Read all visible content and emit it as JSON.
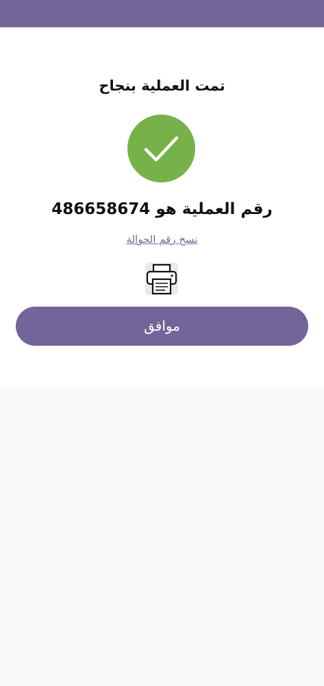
{
  "header": {
    "color": "#73659a"
  },
  "result": {
    "title": "تمت العملية بنجاح",
    "status_icon": "check-circle-icon",
    "success_color": "#76b249",
    "transaction_label": "رقم العملية هو",
    "transaction_number": "486658674",
    "copy_link_label": "نسخ رقم الحوالة",
    "print_icon": "printer-icon"
  },
  "actions": {
    "ok_label": "موافق",
    "accent": "#73659a"
  }
}
